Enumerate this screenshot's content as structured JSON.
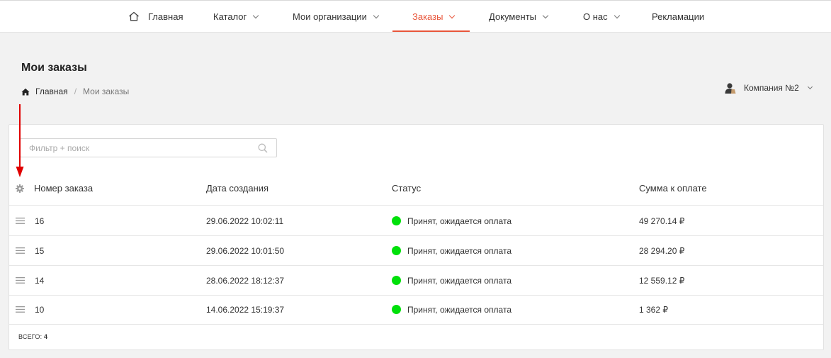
{
  "nav": {
    "items": [
      {
        "label": "Главная",
        "icon": "home-icon",
        "dropdown": false,
        "active": false
      },
      {
        "label": "Каталог",
        "dropdown": true,
        "active": false
      },
      {
        "label": "Мои организации",
        "dropdown": true,
        "active": false
      },
      {
        "label": "Заказы",
        "dropdown": true,
        "active": true
      },
      {
        "label": "Документы",
        "dropdown": true,
        "active": false
      },
      {
        "label": "О нас",
        "dropdown": true,
        "active": false
      },
      {
        "label": "Рекламации",
        "dropdown": false,
        "active": false
      }
    ],
    "accent_color": "#e8553a"
  },
  "page": {
    "title": "Мои заказы",
    "breadcrumb": {
      "home": "Главная",
      "separator": "/",
      "current": "Мои заказы"
    }
  },
  "company": {
    "label": "Компания №2",
    "icon": "user-icon"
  },
  "filter": {
    "placeholder": "Фильтр + поиск",
    "value": "",
    "icon": "search-icon"
  },
  "table": {
    "settings_icon": "gear-icon",
    "columns": [
      "Номер заказа",
      "Дата создания",
      "Статус",
      "Сумма к оплате"
    ],
    "rows": [
      {
        "number": "16",
        "date": "29.06.2022 10:02:11",
        "status": "Принят, ожидается оплата",
        "sum": "49 270.14 ₽"
      },
      {
        "number": "15",
        "date": "29.06.2022 10:01:50",
        "status": "Принят, ожидается оплата",
        "sum": "28 294.20 ₽"
      },
      {
        "number": "14",
        "date": "28.06.2022 18:12:37",
        "status": "Принят, ожидается оплата",
        "sum": "12 559.12 ₽"
      },
      {
        "number": "10",
        "date": "14.06.2022 15:19:37",
        "status": "Принят, ожидается оплата",
        "sum": "1 362 ₽"
      }
    ],
    "status_color": "#00e00a",
    "total_label": "ВСЕГО:",
    "total_value": "4"
  },
  "annotation": {
    "arrow_color": "#e00000"
  }
}
